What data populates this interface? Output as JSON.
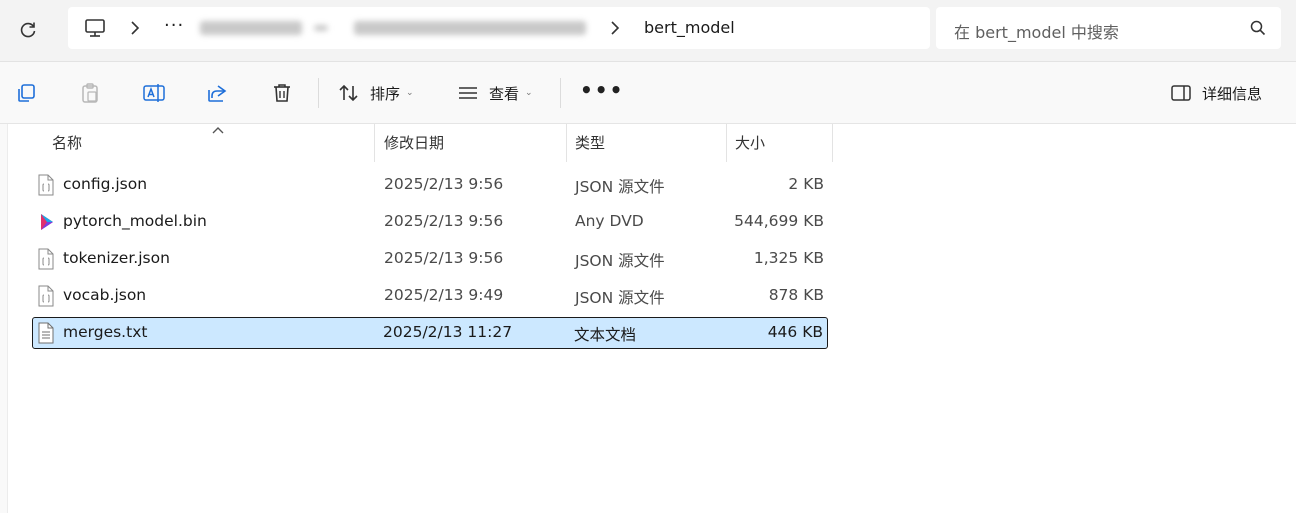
{
  "address_bar": {
    "current_folder": "bert_model",
    "overflow_label": "···"
  },
  "search": {
    "placeholder": "在 bert_model 中搜索"
  },
  "toolbar": {
    "sort_label": "排序",
    "view_label": "查看",
    "more_label": "•••",
    "details_label": "详细信息"
  },
  "columns": {
    "name": "名称",
    "date": "修改日期",
    "type": "类型",
    "size": "大小"
  },
  "files": [
    {
      "name": "config.json",
      "date": "2025/2/13 9:56",
      "type": "JSON 源文件",
      "size": "2 KB",
      "icon": "json-file-icon",
      "selected": false
    },
    {
      "name": "pytorch_model.bin",
      "date": "2025/2/13 9:56",
      "type": "Any DVD",
      "size": "544,699 KB",
      "icon": "media-file-icon",
      "selected": false
    },
    {
      "name": "tokenizer.json",
      "date": "2025/2/13 9:56",
      "type": "JSON 源文件",
      "size": "1,325 KB",
      "icon": "json-file-icon",
      "selected": false
    },
    {
      "name": "vocab.json",
      "date": "2025/2/13 9:49",
      "type": "JSON 源文件",
      "size": "878 KB",
      "icon": "json-file-icon",
      "selected": false
    },
    {
      "name": "merges.txt",
      "date": "2025/2/13 11:27",
      "type": "文本文档",
      "size": "446 KB",
      "icon": "text-file-icon",
      "selected": true
    }
  ],
  "colors": {
    "selection_bg": "#cce8ff",
    "accent_blue": "#1e88e5"
  }
}
